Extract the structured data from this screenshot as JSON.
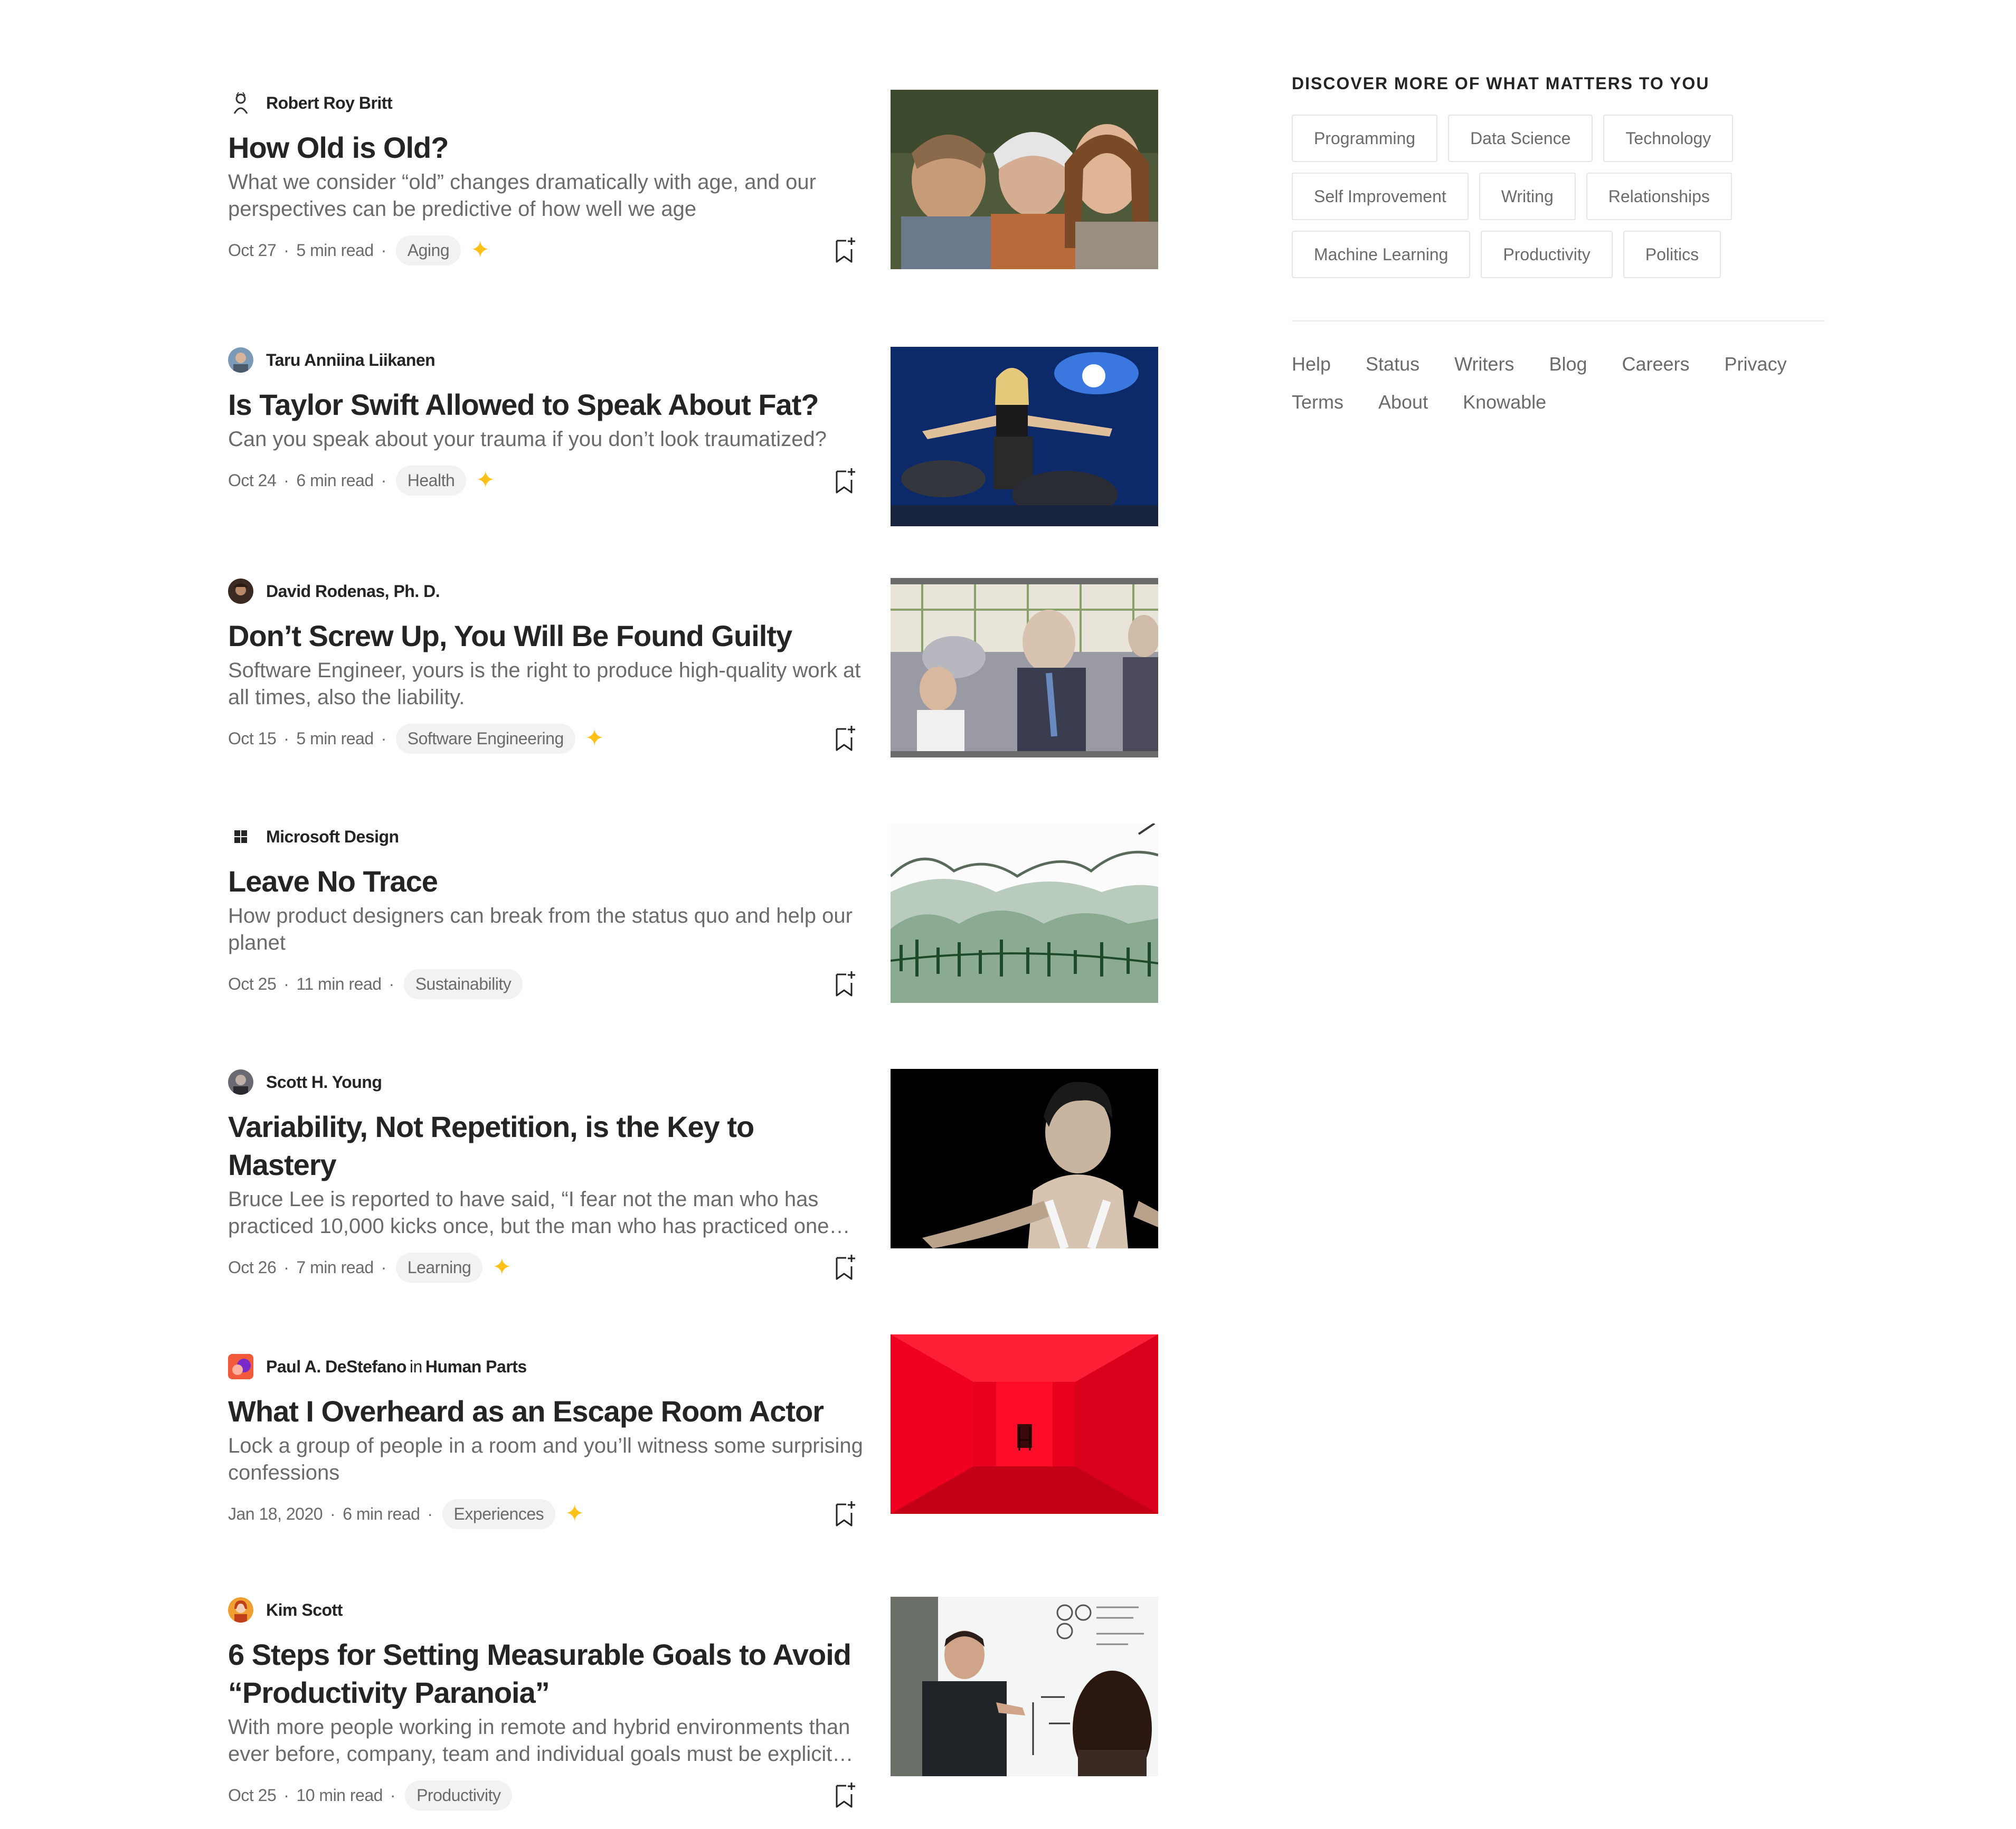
{
  "articles": [
    {
      "author": "Robert Roy Britt",
      "publication": "",
      "title": "How Old is Old?",
      "subtitle": "What we consider “old” changes dramatically with age, and our perspectives can be predictive of how well we age",
      "date": "Oct 27",
      "read_time": "5 min read",
      "tag": "Aging",
      "member_star": true
    },
    {
      "author": "Taru Anniina Liikanen",
      "publication": "",
      "title": "Is Taylor Swift Allowed to Speak About Fat?",
      "subtitle": "Can you speak about your trauma if you don’t look traumatized?",
      "date": "Oct 24",
      "read_time": "6 min read",
      "tag": "Health",
      "member_star": true
    },
    {
      "author": "David Rodenas, Ph. D.",
      "publication": "",
      "title": "Don’t Screw Up, You Will Be Found Guilty",
      "subtitle": "Software Engineer, yours is the right to produce high-quality work at all times, also the liability.",
      "date": "Oct 15",
      "read_time": "5 min read",
      "tag": "Software Engineering",
      "member_star": true
    },
    {
      "author": "Microsoft Design",
      "publication": "",
      "title": "Leave No Trace",
      "subtitle": "How product designers can break from the status quo and help our planet",
      "date": "Oct 25",
      "read_time": "11 min read",
      "tag": "Sustainability",
      "member_star": false
    },
    {
      "author": "Scott H. Young",
      "publication": "",
      "title": "Variability, Not Repetition, is the Key to Mastery",
      "subtitle": "Bruce Lee is reported to have said, “I fear not the man who has practiced 10,000 kicks once, but the man who has practiced one…",
      "date": "Oct 26",
      "read_time": "7 min read",
      "tag": "Learning",
      "member_star": true
    },
    {
      "author": "Paul A. DeStefano",
      "in_word": "in",
      "publication": "Human Parts",
      "title": "What I Overheard as an Escape Room Actor",
      "subtitle": "Lock a group of people in a room and you’ll witness some surprising confessions",
      "date": "Jan 18, 2020",
      "read_time": "6 min read",
      "tag": "Experiences",
      "member_star": true
    },
    {
      "author": "Kim Scott",
      "publication": "",
      "title": "6 Steps for Setting Measurable Goals to Avoid “Productivity Paranoia”",
      "subtitle": "With more people working in remote and hybrid environments than ever before, company, team and individual goals must be explicit…",
      "date": "Oct 25",
      "read_time": "10 min read",
      "tag": "Productivity",
      "member_star": false
    }
  ],
  "separator": "·",
  "star_glyph": "✦",
  "sidebar": {
    "title": "DISCOVER MORE OF WHAT MATTERS TO YOU",
    "topics": [
      "Programming",
      "Data Science",
      "Technology",
      "Self Improvement",
      "Writing",
      "Relationships",
      "Machine Learning",
      "Productivity",
      "Politics"
    ],
    "footer_links": [
      "Help",
      "Status",
      "Writers",
      "Blog",
      "Careers",
      "Privacy",
      "Terms",
      "About",
      "Knowable"
    ]
  },
  "colors": {
    "text": "#242424",
    "muted": "#6b6b6b",
    "star": "#ffc017",
    "tag_bg": "#f2f2f2",
    "border": "#e6e6e6"
  }
}
